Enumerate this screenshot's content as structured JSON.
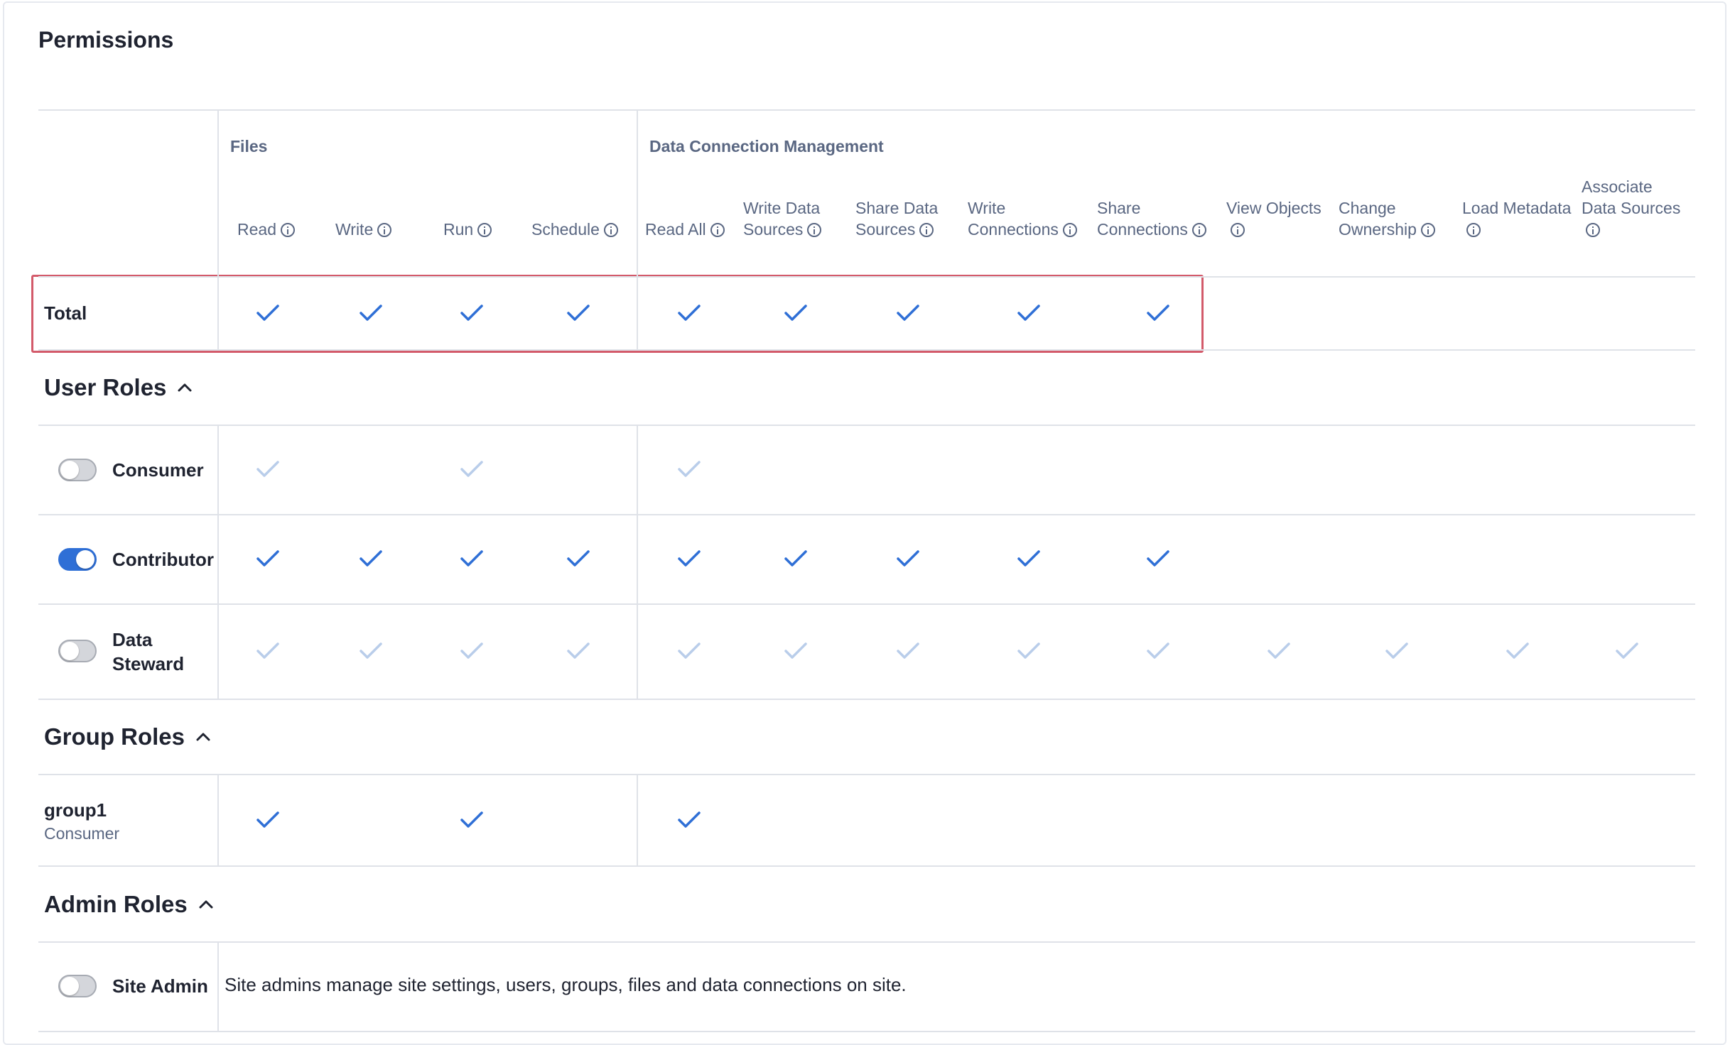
{
  "page_title": "Permissions",
  "groups": {
    "files": "Files",
    "data_connection": "Data Connection Management"
  },
  "columns": [
    {
      "label": "Read",
      "info": true
    },
    {
      "label": "Write",
      "info": true
    },
    {
      "label": "Run",
      "info": true
    },
    {
      "label": "Schedule",
      "info": true
    },
    {
      "label": "Read All",
      "info": true
    },
    {
      "label": "Write Data Sources",
      "info": true
    },
    {
      "label": "Share Data Sources",
      "info": true
    },
    {
      "label": "Write Connections",
      "info": true
    },
    {
      "label": "Share Connections",
      "info": true
    },
    {
      "label": "View Objects",
      "info": true
    },
    {
      "label": "Change Ownership",
      "info": true
    },
    {
      "label": "Load Metadata",
      "info": true
    },
    {
      "label": "Associate Data Sources",
      "info": true
    }
  ],
  "total_row": {
    "label": "Total",
    "checks": [
      "on",
      "on",
      "on",
      "on",
      "on",
      "on",
      "on",
      "on",
      "on",
      "none",
      "none",
      "none",
      "none"
    ]
  },
  "sections": {
    "user_roles": "User Roles",
    "group_roles": "Group Roles",
    "admin_roles": "Admin Roles"
  },
  "user_roles": [
    {
      "label": "Consumer",
      "toggle": "off",
      "checks": [
        "faint",
        "none",
        "faint",
        "none",
        "faint",
        "none",
        "none",
        "none",
        "none",
        "none",
        "none",
        "none",
        "none"
      ]
    },
    {
      "label": "Contributor",
      "toggle": "on",
      "checks": [
        "on",
        "on",
        "on",
        "on",
        "on",
        "on",
        "on",
        "on",
        "on",
        "none",
        "none",
        "none",
        "none"
      ]
    },
    {
      "label": "Data Steward",
      "toggle": "off",
      "checks": [
        "faint",
        "faint",
        "faint",
        "faint",
        "faint",
        "faint",
        "faint",
        "faint",
        "faint",
        "faint",
        "faint",
        "faint",
        "faint"
      ]
    }
  ],
  "group_roles": [
    {
      "name": "group1",
      "role": "Consumer",
      "checks": [
        "on",
        "none",
        "on",
        "none",
        "on",
        "none",
        "none",
        "none",
        "none",
        "none",
        "none",
        "none",
        "none"
      ]
    }
  ],
  "admin_roles": [
    {
      "label": "Site Admin",
      "toggle": "off",
      "description": "Site admins manage site settings, users, groups, files and data connections on site."
    }
  ],
  "colors": {
    "check_active": "#2f6fd6",
    "check_faint": "#b9cdea",
    "toggle_on": "#2f6fd6",
    "highlight": "#d35a6a"
  }
}
